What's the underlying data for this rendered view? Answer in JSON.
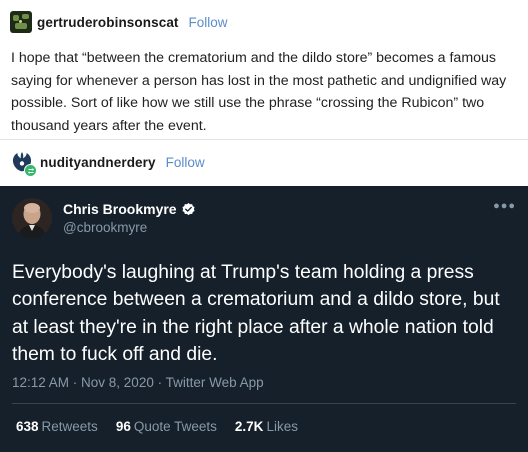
{
  "post": {
    "username": "gertruderobinsonscat",
    "follow_label": "Follow",
    "body": "I hope that “between the crematorium and the dildo store” becomes a famous saying for whenever a person has lost in the most pathetic and undignified way possible. Sort of like how we still use the phrase “crossing the Rubicon” two thousand years after the event."
  },
  "reblog": {
    "username": "nudityandnerdery",
    "follow_label": "Follow"
  },
  "tweet": {
    "name": "Chris Brookmyre",
    "handle": "@cbrookmyre",
    "text": "Everybody's laughing at Trump's team holding a press conference between a crematorium and a dildo store, but at least they're in the right place after a whole nation told them to fuck off and die.",
    "timestamp": "12:12 AM · Nov 8, 2020 · Twitter Web App",
    "stats": [
      {
        "count": "638",
        "label": "Retweets"
      },
      {
        "count": "96",
        "label": "Quote Tweets"
      },
      {
        "count": "2.7K",
        "label": "Likes"
      }
    ]
  },
  "colors": {
    "follow_link": "#5b8cc9",
    "tweet_background": "#15202b",
    "tweet_secondary_text": "#8899a6",
    "verified_badge": "#ffffff",
    "reblog_badge": "#35b86b"
  },
  "icons": {
    "tumblr_avatar": "pixel-art-cat-avatar",
    "reblog_avatar": "rebel-alliance-icon",
    "reblog_badge": "reblog-icon",
    "verified": "verified-badge-icon",
    "more": "more-options-icon"
  }
}
